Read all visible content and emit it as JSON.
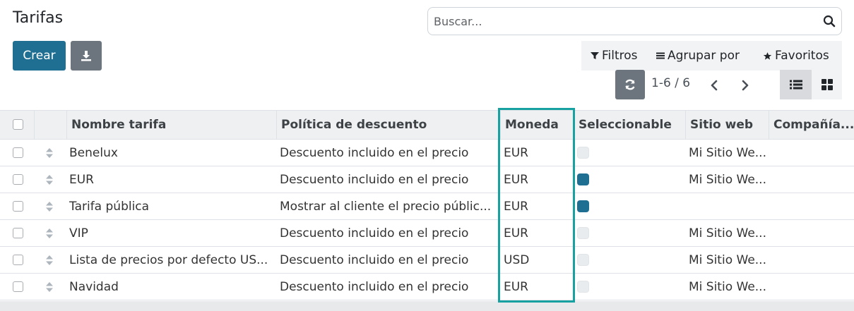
{
  "page": {
    "title": "Tarifas"
  },
  "search": {
    "placeholder": "Buscar..."
  },
  "toolbar": {
    "create_label": "Crear"
  },
  "filters": {
    "filters_label": "Filtros",
    "group_label": "Agrupar por",
    "favorites_label": "Favoritos"
  },
  "pager": {
    "text": "1-6 / 6"
  },
  "table": {
    "columns": [
      "Nombre tarifa",
      "Política de descuento",
      "Moneda",
      "Seleccionable",
      "Sitio web",
      "Compañía..."
    ],
    "rows": [
      {
        "name": "Benelux",
        "policy": "Descuento incluido en el precio",
        "currency": "EUR",
        "selectable": false,
        "website": "Mi Sitio We..."
      },
      {
        "name": "EUR",
        "policy": "Descuento incluido en el precio",
        "currency": "EUR",
        "selectable": true,
        "website": "Mi Sitio We..."
      },
      {
        "name": "Tarifa pública",
        "policy": "Mostrar al cliente el precio públic...",
        "currency": "EUR",
        "selectable": true,
        "website": ""
      },
      {
        "name": "VIP",
        "policy": "Descuento incluido en el precio",
        "currency": "EUR",
        "selectable": false,
        "website": "Mi Sitio We..."
      },
      {
        "name": "Lista de precios por defecto US...",
        "policy": "Descuento incluido en el precio",
        "currency": "USD",
        "selectable": false,
        "website": "Mi Sitio We..."
      },
      {
        "name": "Navidad",
        "policy": "Descuento incluido en el precio",
        "currency": "EUR",
        "selectable": false,
        "website": "Mi Sitio We..."
      }
    ]
  },
  "colors": {
    "primary": "#1f6f93",
    "secondary": "#6c757d",
    "highlight": "#17a2a1"
  },
  "icons": [
    "search-icon",
    "download-icon",
    "filter-icon",
    "group-by-icon",
    "star-icon",
    "refresh-icon",
    "chevron-left-icon",
    "chevron-right-icon",
    "list-view-icon",
    "kanban-view-icon",
    "drag-handle-icon"
  ]
}
